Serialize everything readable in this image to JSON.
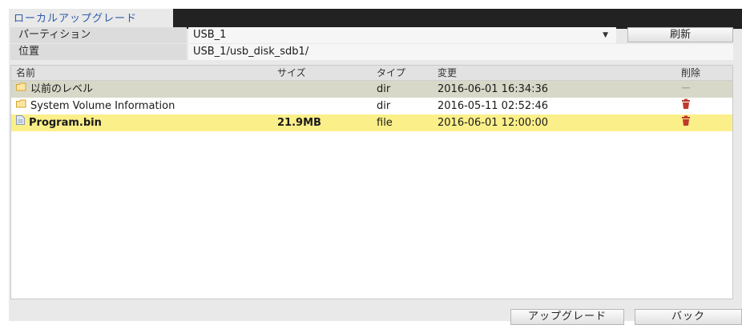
{
  "tab": {
    "label": "ローカルアップグレード"
  },
  "form": {
    "partition_label": "パーティション",
    "partition_value": "USB_1",
    "location_label": "位置",
    "location_value": "USB_1/usb_disk_sdb1/",
    "refresh_label": "刷新"
  },
  "table": {
    "headers": {
      "name": "名前",
      "size": "サイズ",
      "type": "タイプ",
      "modified": "変更",
      "delete": "削除"
    },
    "rows": [
      {
        "icon": "folder-icon",
        "name": "以前のレベル",
        "size": "",
        "type": "dir",
        "modified": "2016-06-01 16:34:36",
        "delete_icon": "dash-icon",
        "selected": false,
        "highlight_color": "#d8d8c8"
      },
      {
        "icon": "folder-icon",
        "name": "System Volume Information",
        "size": "",
        "type": "dir",
        "modified": "2016-05-11 02:52:46",
        "delete_icon": "trash-icon",
        "selected": false,
        "highlight_color": "#ffffff"
      },
      {
        "icon": "file-icon",
        "name": "Program.bin",
        "size": "21.9MB",
        "type": "file",
        "modified": "2016-06-01 12:00:00",
        "delete_icon": "trash-icon",
        "selected": true,
        "highlight_color": "#fbef8a"
      }
    ]
  },
  "footer": {
    "upgrade_label": "アップグレード",
    "back_label": "バック"
  },
  "colors": {
    "tab_text": "#2c5aa8",
    "tab_bar": "#222222",
    "trash": "#c0392b",
    "folder": "#d9a52a",
    "selected_row": "#fbef8a"
  }
}
